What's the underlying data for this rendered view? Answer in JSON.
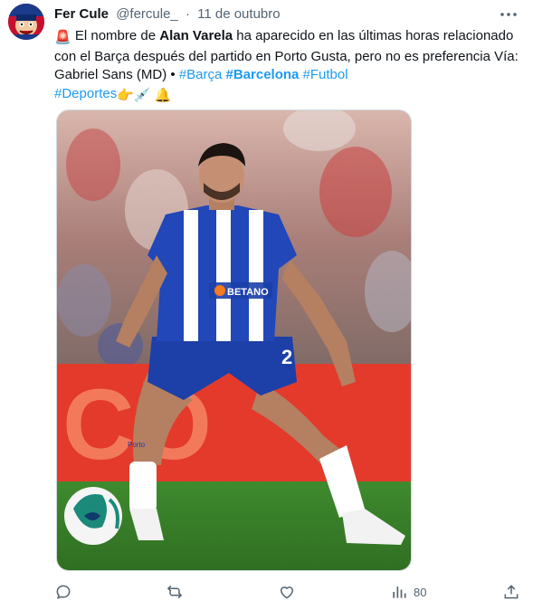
{
  "tweet": {
    "author_name": "Fer Cule",
    "author_handle": "@fercule_",
    "separator": "·",
    "date": "11 de outubro",
    "text_part1": " El nombre de ",
    "text_bold": "Alan Varela",
    "text_part2": " ha aparecido en las últimas horas relacionado con el Barça después del partido en Porto  Gusta, pero no es preferencia Vía: Gabriel Sans (MD)  • ",
    "hashtags": [
      "#Barça",
      "#Barcelona",
      "#Futbol",
      "#Deportes"
    ],
    "emojis": {
      "siren": "🚨",
      "point": "👉",
      "syringe": "💉",
      "bell": "🔔"
    }
  },
  "media": {
    "jersey_sponsor": "BETANO",
    "sock_text": "Porto",
    "shirt_number": "2",
    "board_text": "CO"
  },
  "actions": {
    "views_count": "80"
  },
  "colors": {
    "link": "#1d9bf0",
    "muted": "#536471",
    "text": "#0f1419"
  }
}
